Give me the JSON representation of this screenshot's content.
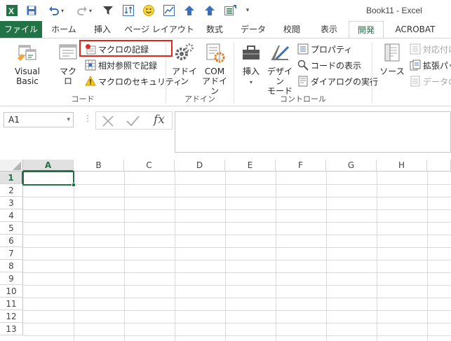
{
  "window": {
    "title": "Book11 - Excel"
  },
  "qat": {
    "items": [
      {
        "name": "excel-logo-icon"
      },
      {
        "name": "save-icon"
      },
      {
        "name": "undo-icon"
      },
      {
        "name": "redo-icon"
      },
      {
        "name": "filter-icon"
      },
      {
        "name": "sort-icon"
      },
      {
        "name": "smiley-icon"
      },
      {
        "name": "chart-icon"
      },
      {
        "name": "upload-icon"
      },
      {
        "name": "upload-icon"
      },
      {
        "name": "form-icon"
      },
      {
        "name": "customize-icon"
      }
    ]
  },
  "tabs": {
    "file": "ファイル",
    "home": "ホーム",
    "insert": "挿入",
    "page_layout": "ページ レイアウト",
    "formulas": "数式",
    "data": "データ",
    "review": "校閲",
    "view": "表示",
    "developer": "開発",
    "acrobat": "ACROBAT"
  },
  "ribbon": {
    "code": {
      "label": "コード",
      "visual_basic": "Visual Basic",
      "macro": "マクロ",
      "record_macro": "マクロの記録",
      "relative_ref": "相対参照で記録",
      "macro_security": "マクロのセキュリティ"
    },
    "addins": {
      "label": "アドイン",
      "addins_btn": "アドイン",
      "com_addins_line1": "COM",
      "com_addins_line2": "アドイン"
    },
    "controls": {
      "label": "コントロール",
      "insert": "挿入",
      "design_mode_line1": "デザイン",
      "design_mode_line2": "モード",
      "properties": "プロパティ",
      "view_code": "コードの表示",
      "run_dialog": "ダイアログの実行"
    },
    "xml": {
      "source": "ソース",
      "map_props": "対応付け",
      "expansion": "拡張パッ",
      "refresh": "データの更"
    }
  },
  "formula_bar": {
    "name_box": "A1",
    "formula": "",
    "fx": "fx"
  },
  "grid": {
    "columns": [
      "A",
      "B",
      "C",
      "D",
      "E",
      "F",
      "G",
      "H"
    ],
    "rows": [
      "1",
      "2",
      "3",
      "4",
      "5",
      "6",
      "7",
      "8",
      "9",
      "10",
      "11",
      "12",
      "13"
    ],
    "active_cell": "A1"
  },
  "colors": {
    "accent": "#217346",
    "highlight": "#e3241b"
  }
}
